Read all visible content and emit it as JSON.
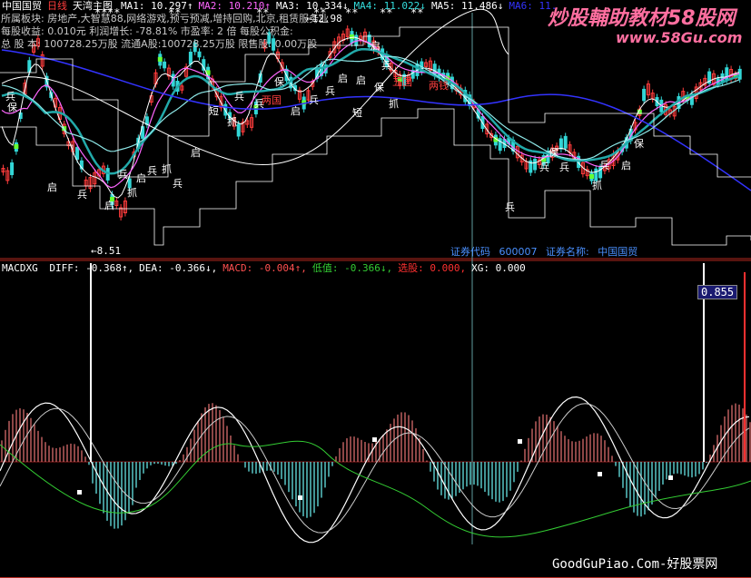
{
  "colors": {
    "background": "#000000",
    "bull": "#ff3c3c",
    "bear": "#33d6d6",
    "ma1": "#ffffff",
    "ma2": "#ff66ff",
    "ma3": "#ffffff",
    "ma4": "#22aaaa",
    "ma5": "#ffffff",
    "ma6": "#3333ff",
    "macd_pos": "#c86464",
    "macd_neg": "#5fd3d3",
    "diff_line": "#ffffff",
    "dea_line": "#cccccc",
    "green_line": "#33cc33",
    "cyan_band": "#55dddd",
    "crosshair": "#5f9ea0",
    "watermark": "#ff6fa0"
  },
  "header": {
    "stock_name": "中国国贸",
    "period": "日线",
    "template": "天湾主图",
    "ma_items": [
      {
        "label": "MA1:",
        "value": "10.297",
        "arrow": "↑",
        "color": "#ffffff"
      },
      {
        "label": "MA2:",
        "value": "10.210",
        "arrow": "↑",
        "color": "#ff66ff"
      },
      {
        "label": "MA3:",
        "value": "10.334",
        "arrow": "↓",
        "color": "#ffffff"
      },
      {
        "label": "MA4:",
        "value": "11.022",
        "arrow": "↓",
        "color": "#33dddd"
      },
      {
        "label": "MA5:",
        "value": "11.486",
        "arrow": "↓",
        "color": "#ffffff"
      },
      {
        "label": "MA6:",
        "value": "11.",
        "arrow": "",
        "color": "#3333ff"
      }
    ]
  },
  "watermark": {
    "top_text": "炒股輔助教材58股网",
    "top_url": "www.58Gu.com",
    "bottom_text": "GoodGuPiao.Com-好股票网"
  },
  "info_panel": {
    "line1": "所属板块:  房地产,大智慧88,网络游戏,预亏预减,增持回购,北京,租赁服务业",
    "line2": "每股收益:  0.010元    利润增长: -78.81%   市盈率: 2 倍   每股公积金:",
    "line3": "总 股 本:  100728.25万股  流通A股:100728.25万股  限售股: 0.00万股"
  },
  "price_labels": {
    "high": "12.98",
    "low": "8.51"
  },
  "signals": {
    "bing": "兵",
    "shi": "启",
    "zhua": "抓",
    "duan": "短",
    "bao": "保",
    "wuguo": "五国",
    "cong": "两国",
    "dongshen": "两钱"
  },
  "stock_info": {
    "code_label": "证券代码",
    "code": "600007",
    "name_label": "证券名称:",
    "name": "中国国贸"
  },
  "indicator": {
    "name": "MACDXG",
    "items": [
      {
        "label": "DIFF:",
        "value": "-0.368",
        "arrow": "↑",
        "color": "#ffffff"
      },
      {
        "label": "DEA:",
        "value": "-0.366",
        "arrow": "↓",
        "color": "#ffffff"
      },
      {
        "label": "MACD:",
        "value": "-0.004",
        "arrow": "↑",
        "color": "#ff5050"
      },
      {
        "label": "低值:",
        "value": "-0.366",
        "arrow": "↓",
        "color": "#33cc33"
      },
      {
        "label": "选股:",
        "value": "0.000",
        "arrow": "",
        "color": "#ff3030"
      },
      {
        "label": "XG:",
        "value": "0.000",
        "arrow": "",
        "color": "#ffffff"
      }
    ],
    "scale_value": "0.855"
  }
}
